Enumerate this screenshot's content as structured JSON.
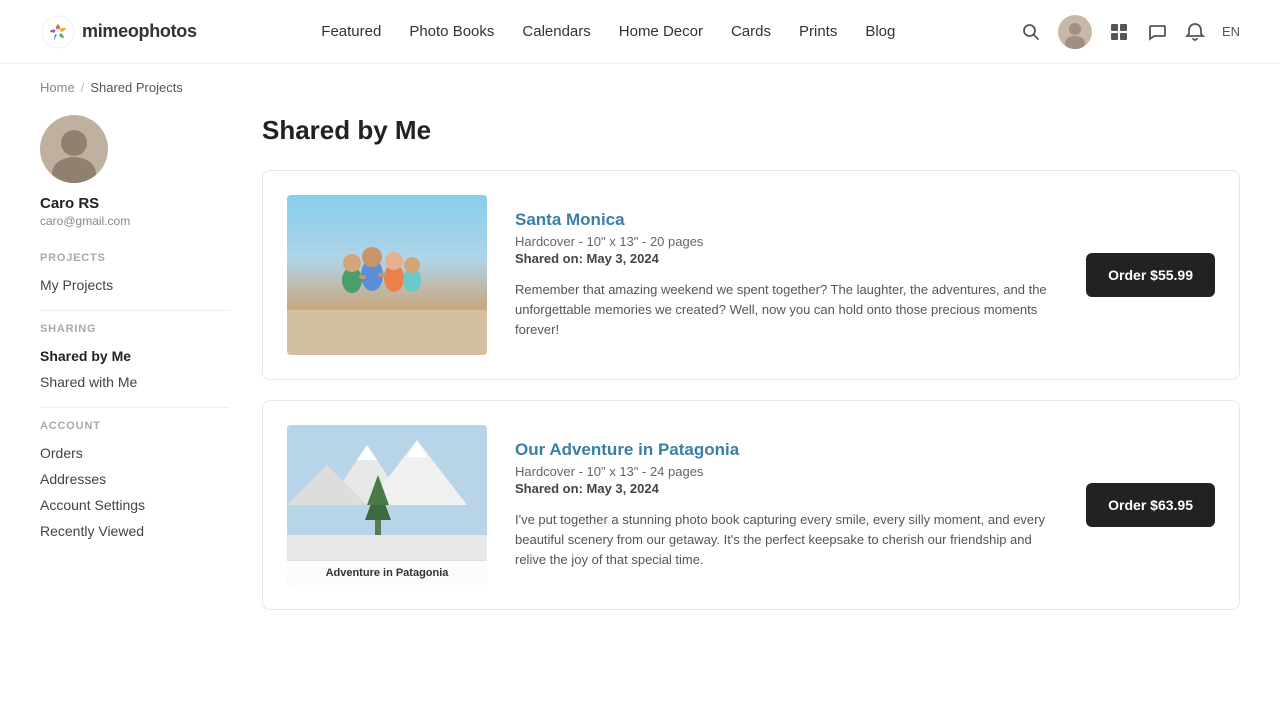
{
  "header": {
    "logo_text": "mimeophotos",
    "nav_items": [
      {
        "label": "Featured",
        "key": "featured"
      },
      {
        "label": "Photo Books",
        "key": "photo-books"
      },
      {
        "label": "Calendars",
        "key": "calendars"
      },
      {
        "label": "Home Decor",
        "key": "home-decor"
      },
      {
        "label": "Cards",
        "key": "cards"
      },
      {
        "label": "Prints",
        "key": "prints"
      },
      {
        "label": "Blog",
        "key": "blog"
      }
    ],
    "lang": "EN"
  },
  "breadcrumb": {
    "home": "Home",
    "separator": "/",
    "current": "Shared Projects"
  },
  "sidebar": {
    "name": "Caro RS",
    "email": "caro@gmail.com",
    "sections": {
      "projects_label": "PROJECTS",
      "projects_items": [
        {
          "label": "My Projects",
          "key": "my-projects",
          "active": false
        }
      ],
      "sharing_label": "SHARING",
      "sharing_items": [
        {
          "label": "Shared by Me",
          "key": "shared-by-me",
          "active": true
        },
        {
          "label": "Shared with Me",
          "key": "shared-with-me",
          "active": false
        }
      ],
      "account_label": "ACCOUNT",
      "account_items": [
        {
          "label": "Orders",
          "key": "orders",
          "active": false
        },
        {
          "label": "Addresses",
          "key": "addresses",
          "active": false
        },
        {
          "label": "Account Settings",
          "key": "account-settings",
          "active": false
        },
        {
          "label": "Recently Viewed",
          "key": "recently-viewed",
          "active": false
        }
      ]
    }
  },
  "page_title": "Shared by Me",
  "projects": [
    {
      "id": "santa-monica",
      "title": "Santa Monica",
      "meta": "Hardcover - 10\" x 13\" - 20 pages",
      "shared_on_label": "Shared on:",
      "shared_on": "May 3, 2024",
      "description": "Remember that amazing weekend we spent together? The laughter, the adventures, and the unforgettable memories we created? Well, now you can hold onto those precious moments forever!",
      "order_label": "Order $55.99"
    },
    {
      "id": "patagonia",
      "title": "Our Adventure in Patagonia",
      "meta": "Hardcover - 10\" x 13\" - 24 pages",
      "shared_on_label": "Shared on:",
      "shared_on": "May 3, 2024",
      "description": "I've put together a stunning photo book capturing every smile, every silly moment, and every beautiful scenery from our getaway. It's the perfect keepsake to cherish our friendship and relive the joy of that special time.",
      "order_label": "Order $63.95",
      "thumbnail_label": "Adventure in Patagonia"
    }
  ]
}
